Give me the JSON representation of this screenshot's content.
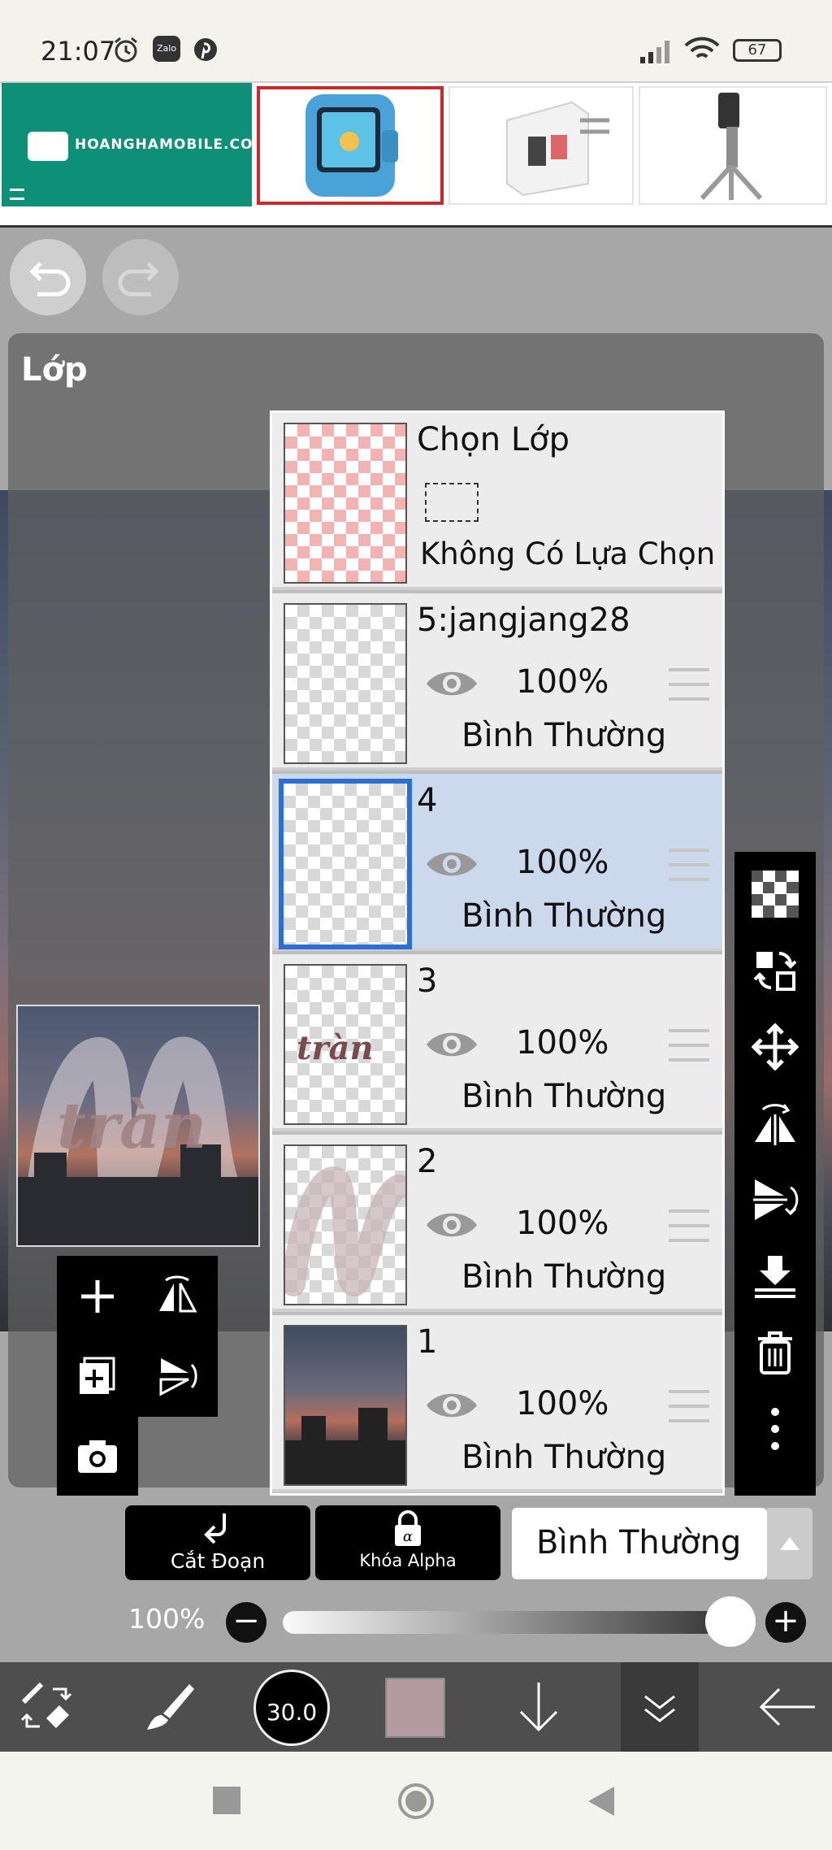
{
  "status_bar": {
    "time": "21:07",
    "icons": [
      "alarm-icon",
      "zalo-icon",
      "pinterest-icon",
      "signal-icon",
      "wifi-icon",
      "battery-icon"
    ],
    "zalo_label": "Zalo",
    "battery": "67"
  },
  "ad_banner": {
    "brand": "HOANGHAMOBILE.COM",
    "products": [
      "smartwatch",
      "charger",
      "gimbal"
    ]
  },
  "layer_panel": {
    "title": "Lớp",
    "selection_layer": {
      "name": "Chọn Lớp",
      "status": "Không Có Lựa Chọn"
    },
    "layers": [
      {
        "name": "5:jangjang28",
        "opacity": "100%",
        "mode": "Bình Thường",
        "selected": false,
        "thumb_text": ""
      },
      {
        "name": "4",
        "opacity": "100%",
        "mode": "Bình Thường",
        "selected": true,
        "thumb_text": ""
      },
      {
        "name": "3",
        "opacity": "100%",
        "mode": "Bình Thường",
        "selected": false,
        "thumb_text": "tràn"
      },
      {
        "name": "2",
        "opacity": "100%",
        "mode": "Bình Thường",
        "selected": false,
        "thumb_text": ""
      },
      {
        "name": "1",
        "opacity": "100%",
        "mode": "Bình Thường",
        "selected": false,
        "thumb_text": ""
      }
    ],
    "preview_text": "tràn"
  },
  "controls": {
    "clipping_label": "Cắt Đoạn",
    "alpha_lock_label": "Khóa Alpha",
    "blend_mode": "Bình Thường",
    "opacity": "100%",
    "opacity_value": 1.0,
    "minus": "−",
    "plus": "+"
  },
  "toolbar": {
    "brush_size": "30.0",
    "color": "#b39aa0"
  },
  "colors": {
    "selected_border": "#2a6fd6",
    "selected_row": "#ccd8ec",
    "brand_green": "#0e8f78"
  }
}
